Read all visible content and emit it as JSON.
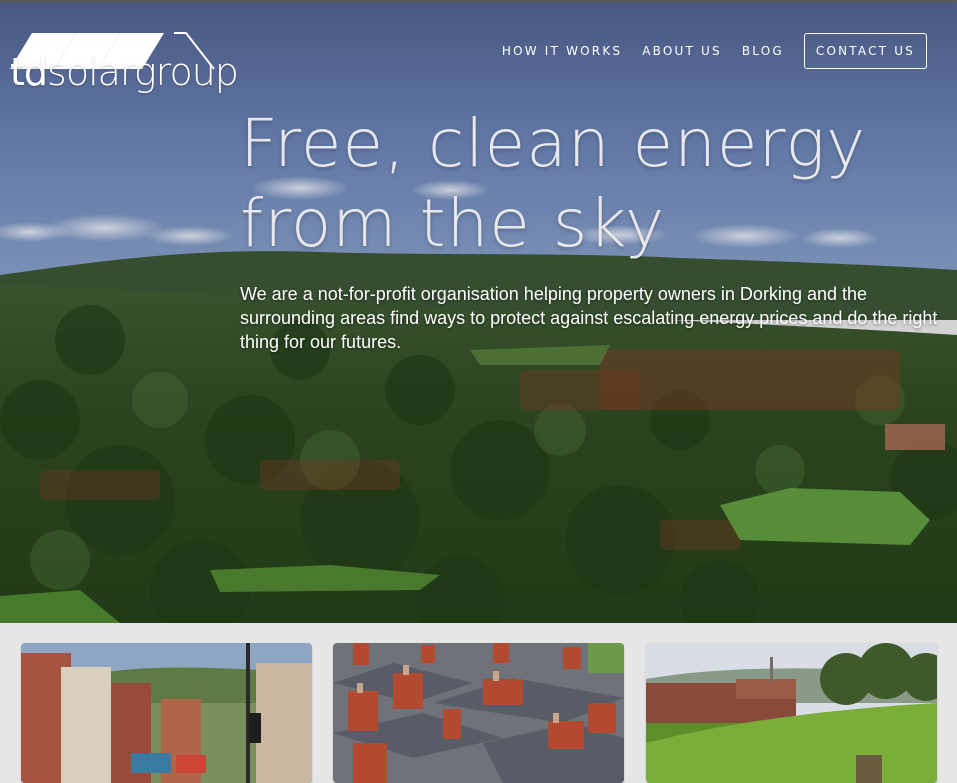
{
  "brand": {
    "logo_text_left": "td",
    "logo_text_right": "solargroup"
  },
  "nav": {
    "items": [
      {
        "label": "HOW IT WORKS"
      },
      {
        "label": "ABOUT US"
      },
      {
        "label": "BLOG"
      }
    ],
    "contact_label": "CONTACT US"
  },
  "hero": {
    "headline_line1": "Free, clean energy",
    "headline_line2": "from the sky",
    "intro": "We are a not-for-profit organisation helping property owners in Dorking and the surrounding areas find ways to protect against escalating energy prices and do the right thing for our futures."
  },
  "colors": {
    "sky": "#5f77a6",
    "forest": "#2d4a1f",
    "roof_red": "#8a3a2a",
    "field_green": "#5f9a3e",
    "card_bg": "#e6e6e6"
  }
}
